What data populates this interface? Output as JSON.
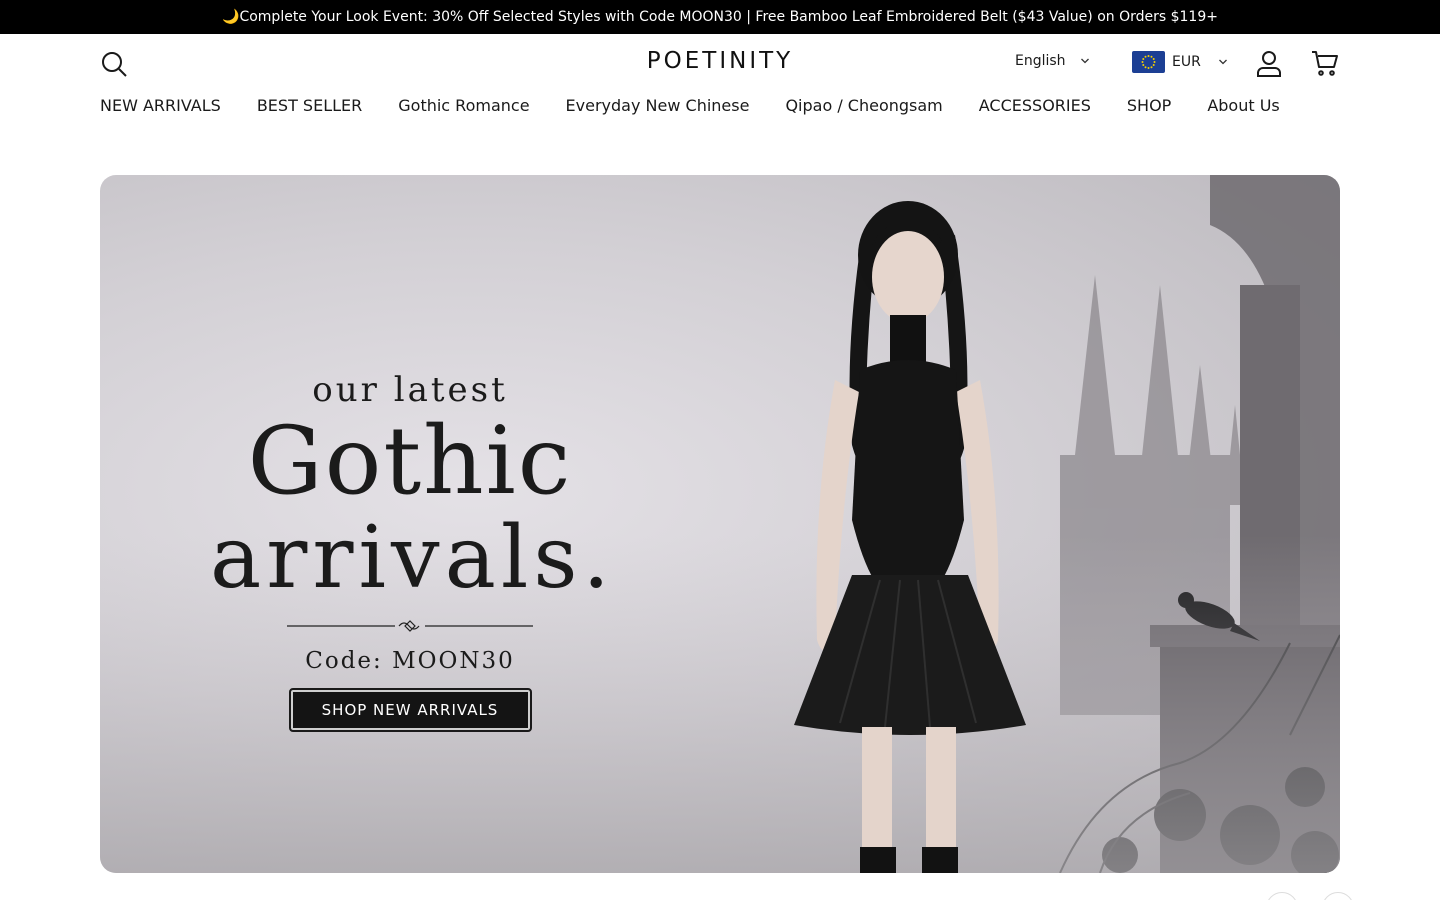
{
  "announcement": {
    "text": "🌙Complete Your Look Event: 30% Off Selected Styles with Code MOON30 | Free Bamboo Leaf Embroidered Belt ($43 Value) on Orders $119+"
  },
  "header": {
    "search_icon": "search-icon",
    "logo": "POETINITY",
    "language": "English",
    "currency": "EUR",
    "account_icon": "user-icon",
    "cart_icon": "cart-icon"
  },
  "nav": {
    "items": [
      {
        "label": "NEW ARRIVALS"
      },
      {
        "label": "BEST SELLER"
      },
      {
        "label": "Gothic Romance"
      },
      {
        "label": "Everyday New Chinese"
      },
      {
        "label": "Qipao / Cheongsam"
      },
      {
        "label": "ACCESSORIES"
      },
      {
        "label": "SHOP"
      },
      {
        "label": "About Us"
      }
    ]
  },
  "hero": {
    "kicker": "our latest",
    "title_line1": "Gothic",
    "title_line2": "arrivals.",
    "code_text": "Code:  MOON30",
    "cta_label": "SHOP NEW ARRIVALS"
  },
  "colors": {
    "announcement_bg": "#000000",
    "cta_bg": "#141414",
    "flag_blue": "#1c3f94",
    "flag_star": "#f5d000"
  }
}
